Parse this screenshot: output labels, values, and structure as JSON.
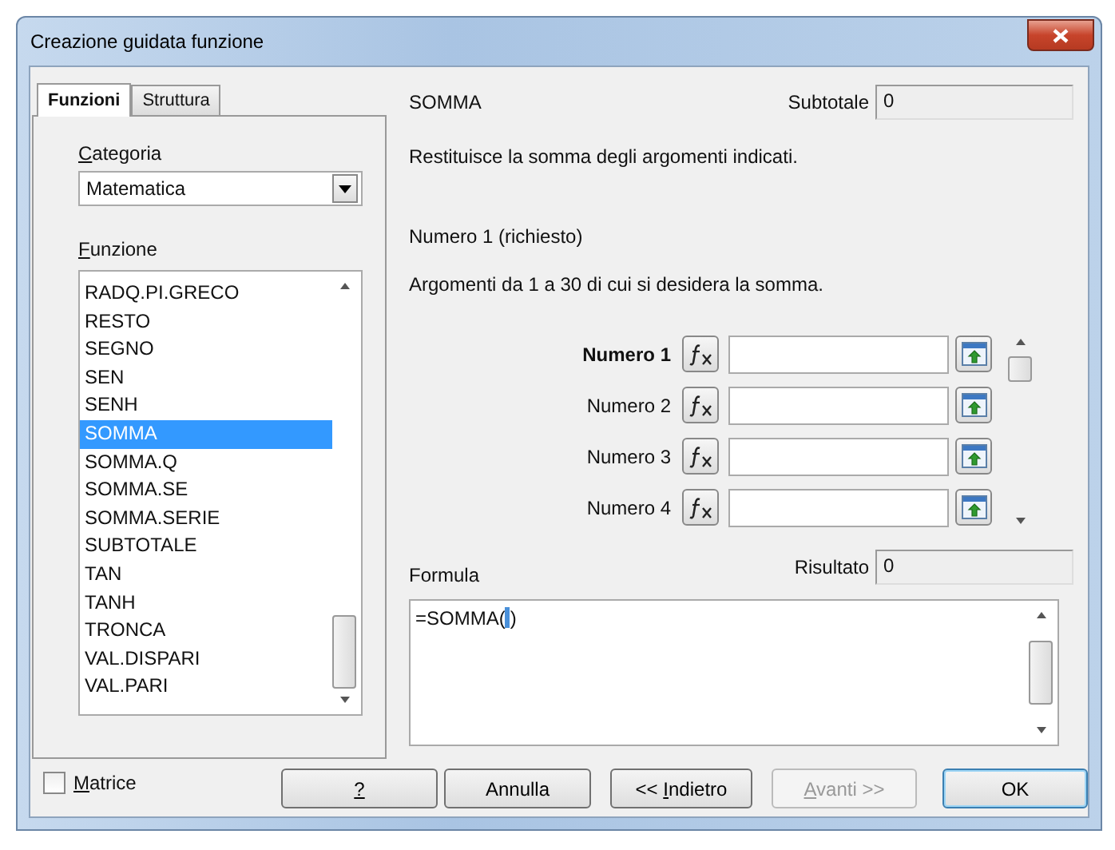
{
  "window": {
    "title": "Creazione guidata funzione"
  },
  "tabs": [
    {
      "label": "Funzioni",
      "selected": true
    },
    {
      "label": "Struttura",
      "selected": false
    }
  ],
  "category": {
    "label": "Categoria",
    "mnemonic": true,
    "value": "Matematica"
  },
  "function_list": {
    "label": "Funzione",
    "mnemonic": true,
    "items": [
      {
        "label": "RADQ.PI.GRECO",
        "selected": false
      },
      {
        "label": "RESTO",
        "selected": false
      },
      {
        "label": "SEGNO",
        "selected": false
      },
      {
        "label": "SEN",
        "selected": false
      },
      {
        "label": "SENH",
        "selected": false
      },
      {
        "label": "SOMMA",
        "selected": true
      },
      {
        "label": "SOMMA.Q",
        "selected": false
      },
      {
        "label": "SOMMA.SE",
        "selected": false
      },
      {
        "label": "SOMMA.SERIE",
        "selected": false
      },
      {
        "label": "SUBTOTALE",
        "selected": false
      },
      {
        "label": "TAN",
        "selected": false
      },
      {
        "label": "TANH",
        "selected": false
      },
      {
        "label": "TRONCA",
        "selected": false
      },
      {
        "label": "VAL.DISPARI",
        "selected": false
      },
      {
        "label": "VAL.PARI",
        "selected": false
      }
    ]
  },
  "matrix": {
    "label": "Matrice",
    "mnemonic": true,
    "checked": false
  },
  "function_name": "SOMMA",
  "subtotal": {
    "label": "Subtotale",
    "value": "0"
  },
  "description": "Restituisce la somma degli argomenti indicati.",
  "argument_title": "Numero 1 (richiesto)",
  "argument_description": "Argomenti da 1 a 30 di cui si desidera la somma.",
  "arguments": [
    {
      "label": "Numero 1",
      "active": true
    },
    {
      "label": "Numero 2",
      "active": false
    },
    {
      "label": "Numero 3",
      "active": false
    },
    {
      "label": "Numero 4",
      "active": false
    }
  ],
  "formula": {
    "label": "Formula",
    "text_before_cursor": "=SOMMA(",
    "text_after_cursor": ")"
  },
  "result": {
    "label": "Risultato",
    "value": "0"
  },
  "buttons": [
    {
      "label": "?",
      "mnemonic": true,
      "disabled": false,
      "default": false
    },
    {
      "label": "Annulla",
      "mnemonic": false,
      "disabled": false,
      "default": false
    },
    {
      "label": "<< Indietro",
      "mnemonic": true,
      "disabled": false,
      "default": false
    },
    {
      "label": "Avanti >>",
      "mnemonic": true,
      "disabled": true,
      "default": false
    },
    {
      "label": "OK",
      "mnemonic": false,
      "disabled": false,
      "default": true
    }
  ]
}
